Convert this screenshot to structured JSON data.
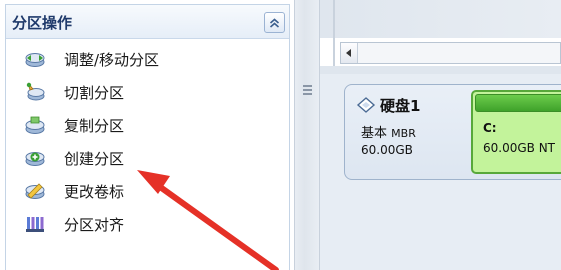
{
  "panel": {
    "title": "分区操作",
    "collapse_icon": "double-chevron-up-icon",
    "items": [
      {
        "label": "调整/移动分区",
        "icon": "resize-partition-icon"
      },
      {
        "label": "切割分区",
        "icon": "split-partition-icon"
      },
      {
        "label": "复制分区",
        "icon": "copy-partition-icon"
      },
      {
        "label": "创建分区",
        "icon": "create-partition-icon"
      },
      {
        "label": "更改卷标",
        "icon": "change-label-icon"
      },
      {
        "label": "分区对齐",
        "icon": "align-partition-icon"
      }
    ]
  },
  "disk": {
    "name": "硬盘1",
    "type": "基本",
    "table": "MBR",
    "size": "60.00GB"
  },
  "partition": {
    "letter": "C:",
    "size": "60.00GB NT"
  },
  "colors": {
    "panel_title": "#1f3a6b",
    "partition_fill": "#c3f39b",
    "partition_bar": "#4cb236",
    "arrow": "#e53127"
  }
}
